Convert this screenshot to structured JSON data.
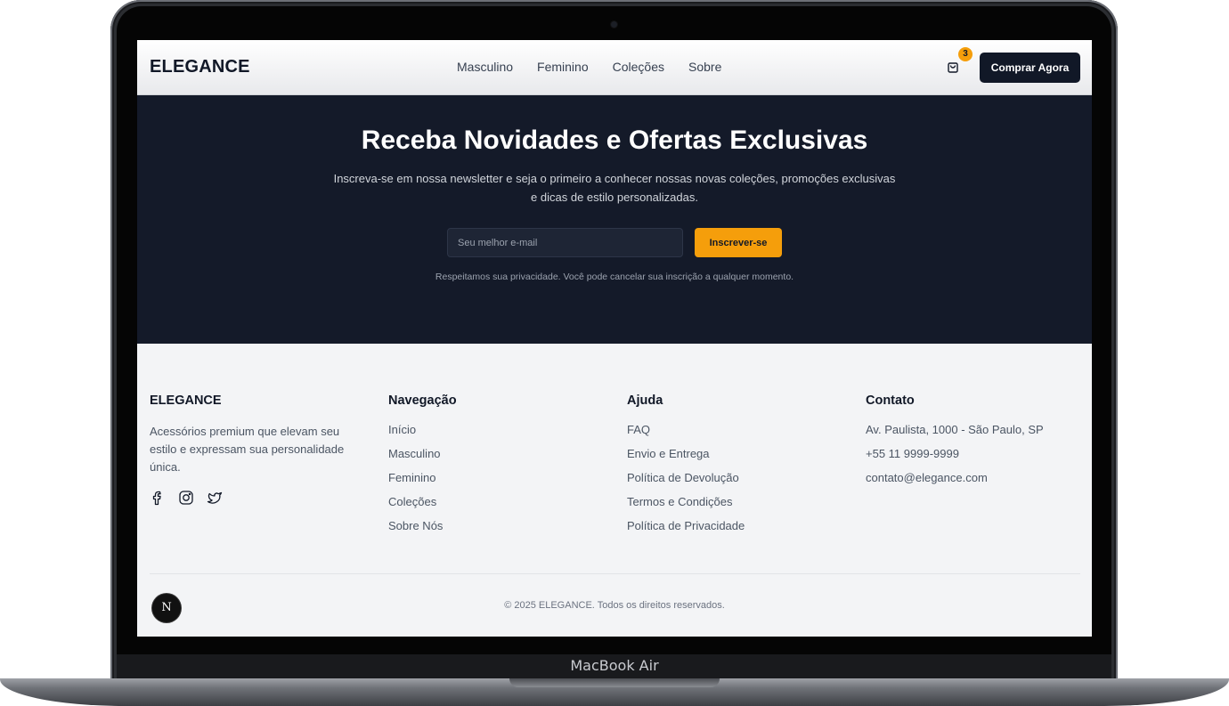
{
  "header": {
    "logo": "ELEGANCE",
    "nav": [
      "Masculino",
      "Feminino",
      "Coleções",
      "Sobre"
    ],
    "cart_count": "3",
    "cta_label": "Comprar Agora"
  },
  "newsletter": {
    "title": "Receba Novidades e Ofertas Exclusivas",
    "subtitle": "Inscreva-se em nossa newsletter e seja o primeiro a conhecer nossas novas coleções, promoções exclusivas e dicas de estilo personalizadas.",
    "email_placeholder": "Seu melhor e-mail",
    "email_value": "",
    "subscribe_label": "Inscrever-se",
    "privacy_note": "Respeitamos sua privacidade. Você pode cancelar sua inscrição a qualquer momento."
  },
  "footer": {
    "brand": {
      "title": "ELEGANCE",
      "description": "Acessórios premium que elevam seu estilo e expressam sua personalidade única.",
      "socials": [
        "facebook-icon",
        "instagram-icon",
        "twitter-icon"
      ]
    },
    "navigation": {
      "title": "Navegação",
      "links": [
        "Início",
        "Masculino",
        "Feminino",
        "Coleções",
        "Sobre Nós"
      ]
    },
    "help": {
      "title": "Ajuda",
      "links": [
        "FAQ",
        "Envio e Entrega",
        "Política de Devolução",
        "Termos e Condições",
        "Política de Privacidade"
      ]
    },
    "contact": {
      "title": "Contato",
      "lines": [
        "Av. Paulista, 1000 - São Paulo, SP",
        "+55 11 9999-9999",
        "contato@elegance.com"
      ]
    },
    "copyright": "© 2025 ELEGANCE. Todos os direitos reservados."
  },
  "dev_badge": "N",
  "device_label": "MacBook Air",
  "colors": {
    "accent": "#f59e0b",
    "dark": "#141a29",
    "primary_button": "#111827"
  }
}
